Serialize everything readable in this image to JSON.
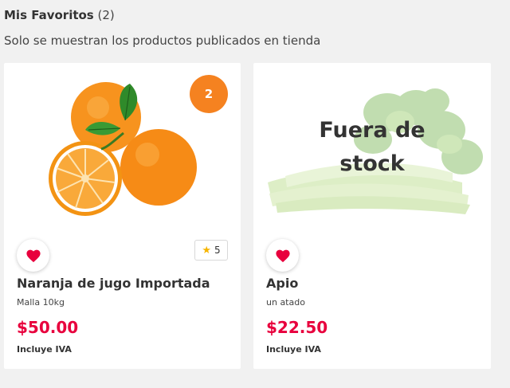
{
  "header": {
    "title": "Mis Favoritos",
    "count": "(2)",
    "subtitle": "Solo se muestran los productos publicados en tienda"
  },
  "products": [
    {
      "name": "Naranja de jugo Importada",
      "unit": "Malla 10kg",
      "price": "$50.00",
      "tax_note": "Incluye IVA",
      "cart_quantity": "2",
      "rating": "5",
      "image_icon": "orange-image",
      "favorite_icon": "heart-icon"
    },
    {
      "name": "Apio",
      "unit": "un atado",
      "price": "$22.50",
      "tax_note": "Incluye IVA",
      "out_of_stock_label": "Fuera de stock",
      "image_icon": "celery-image",
      "favorite_icon": "heart-icon"
    }
  ],
  "colors": {
    "price": "#e8003d",
    "badge": "#f58220",
    "heart": "#e8003d",
    "star": "#f7b500"
  }
}
